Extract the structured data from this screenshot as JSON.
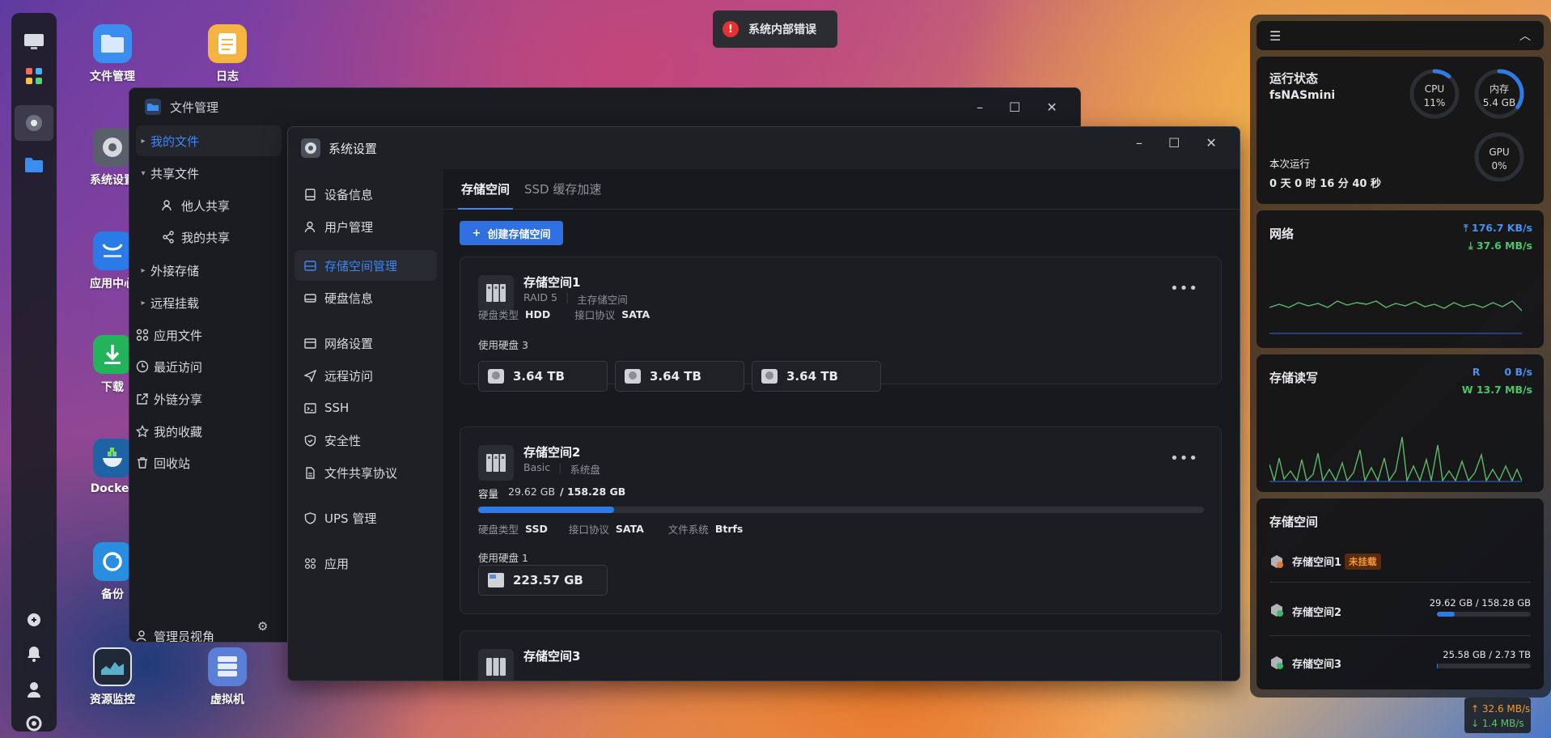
{
  "desktop": {
    "icons": [
      {
        "label": "文件管理",
        "icon": "folder-icon",
        "color": "#3b8ef0"
      },
      {
        "label": "日志",
        "icon": "notes-icon",
        "color": "#f5b342"
      },
      {
        "label": "系统设置",
        "icon": "gear-icon",
        "color": "#59606b"
      },
      {
        "label": "应用中心",
        "icon": "store-icon",
        "color": "#2a7ae8"
      },
      {
        "label": "下载",
        "icon": "download-icon",
        "color": "#22b35b"
      },
      {
        "label": "Docker",
        "icon": "docker-icon",
        "color": "#1d63a6"
      },
      {
        "label": "备份",
        "icon": "backup-icon",
        "color": "#2a8ee0"
      },
      {
        "label": "资源监控",
        "icon": "monitor-icon",
        "color": "#1f2a36"
      },
      {
        "label": "虚拟机",
        "icon": "vm-icon",
        "color": "#5a7fd6"
      }
    ]
  },
  "toast": {
    "text": "系统内部错误",
    "color": "#e5322e"
  },
  "file_manager": {
    "title": "文件管理",
    "nav": [
      {
        "label": "我的文件",
        "active": true
      },
      {
        "label": "共享文件"
      },
      {
        "label": "他人共享"
      },
      {
        "label": "我的共享"
      },
      {
        "label": "外接存储"
      },
      {
        "label": "远程挂载"
      },
      {
        "label": "应用文件"
      },
      {
        "label": "最近访问"
      },
      {
        "label": "外链分享"
      },
      {
        "label": "我的收藏"
      },
      {
        "label": "回收站"
      }
    ],
    "footer": "管理员视角"
  },
  "settings": {
    "title": "系统设置",
    "nav": [
      {
        "label": "设备信息"
      },
      {
        "label": "用户管理"
      },
      {
        "label": "存储空间管理",
        "active": true
      },
      {
        "label": "硬盘信息"
      },
      {
        "label": "网络设置"
      },
      {
        "label": "远程访问"
      },
      {
        "label": "SSH"
      },
      {
        "label": "安全性"
      },
      {
        "label": "文件共享协议"
      },
      {
        "label": "UPS 管理"
      },
      {
        "label": "应用"
      }
    ],
    "tabs": [
      "存储空间",
      "SSD 缓存加速"
    ],
    "create_button": "创建存储空间",
    "pools": [
      {
        "name": "存储空间1",
        "raid": "RAID 5",
        "role": "主存储空间",
        "disk_type_label": "硬盘类型",
        "disk_type": "HDD",
        "interface_label": "接口协议",
        "interface": "SATA",
        "used_label": "使用硬盘 3",
        "disks": [
          "3.64 TB",
          "3.64 TB",
          "3.64 TB"
        ]
      },
      {
        "name": "存储空间2",
        "raid": "Basic",
        "role": "系统盘",
        "capacity_label": "容量",
        "capacity_used": "29.62 GB",
        "capacity_total": "/ 158.28 GB",
        "usage_fraction": 0.187,
        "disk_type_label": "硬盘类型",
        "disk_type": "SSD",
        "interface_label": "接口协议",
        "interface": "SATA",
        "fs_label": "文件系统",
        "fs": "Btrfs",
        "used_label": "使用硬盘 1",
        "disks": [
          "223.57 GB"
        ]
      },
      {
        "name": "存储空间3"
      }
    ]
  },
  "widgets": {
    "status": {
      "title": "运行状态",
      "host": "fsNASmini",
      "uptime_label": "本次运行",
      "uptime": "0 天 0 时 16 分 40 秒",
      "cpu": {
        "label": "CPU",
        "value": "11%",
        "fraction": 0.11
      },
      "mem": {
        "label": "内存",
        "value": "5.4 GB",
        "fraction": 0.35
      },
      "gpu": {
        "label": "GPU",
        "value": "0%",
        "fraction": 0
      }
    },
    "network": {
      "title": "网络",
      "up": "176.7 KB/s",
      "down": "37.6 MB/s"
    },
    "io": {
      "title": "存储读写",
      "read_label": "R",
      "read": "0 B/s",
      "write": "W 13.7 MB/s"
    },
    "storage": {
      "title": "存储空间",
      "items": [
        {
          "name": "存储空间1",
          "badge": "未挂载"
        },
        {
          "name": "存储空间2",
          "usage": "29.62 GB / 158.28 GB",
          "fraction": 0.187
        },
        {
          "name": "存储空间3",
          "usage": "25.58 GB / 2.73 TB",
          "fraction": 0.01
        }
      ]
    }
  },
  "speed_indicator": {
    "up": "↑ 32.6 MB/s",
    "down": "↓ 1.4 MB/s"
  }
}
